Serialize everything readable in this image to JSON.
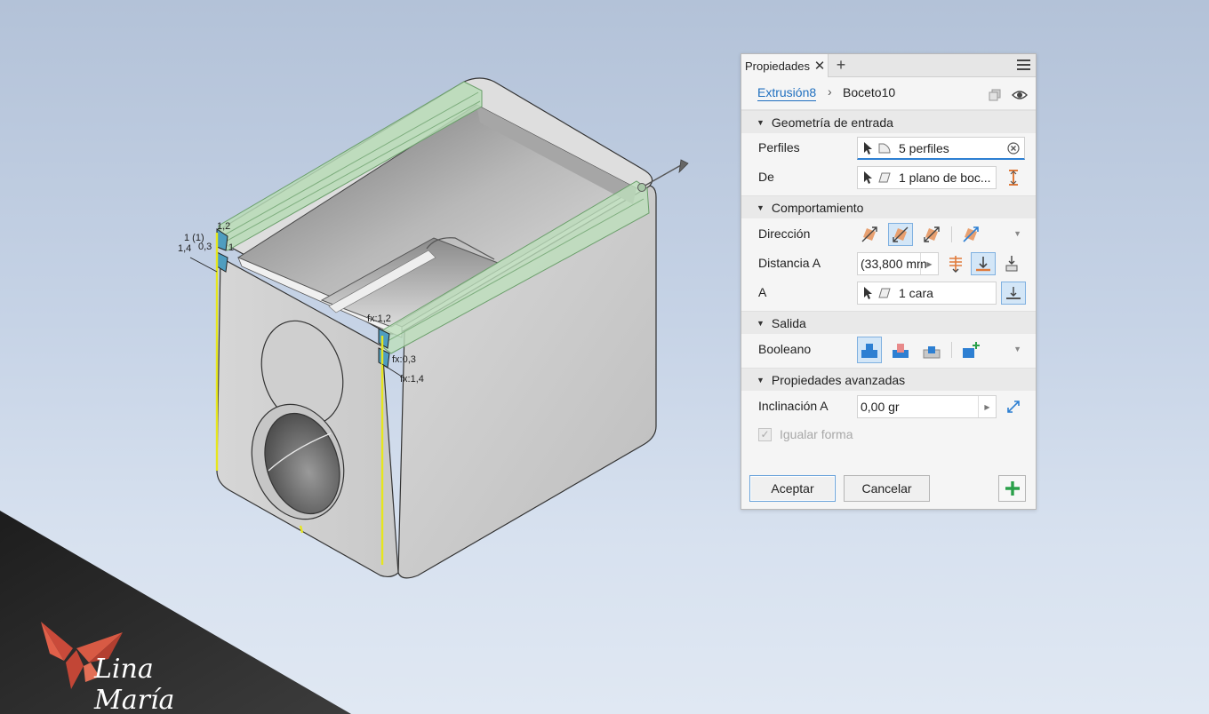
{
  "panel": {
    "tab_title": "Propiedades",
    "tab_close": "✕",
    "tab_add": "+",
    "breadcrumb": {
      "link": "Extrusión8",
      "separator": "›",
      "current": "Boceto10"
    },
    "sections": {
      "input_geometry": "Geometría de entrada",
      "behavior": "Comportamiento",
      "output": "Salida",
      "advanced": "Propiedades avanzadas"
    },
    "profiles": {
      "label": "Perfiles",
      "value": "5 perfiles"
    },
    "from": {
      "label": "De",
      "value": "1 plano de boc..."
    },
    "direction": {
      "label": "Dirección"
    },
    "distance": {
      "label": "Distancia A",
      "value": "(33,800 mm"
    },
    "to": {
      "label": "A",
      "value": "1 cara"
    },
    "boolean": {
      "label": "Booleano"
    },
    "taper": {
      "label": "Inclinación A",
      "value": "0,00 gr"
    },
    "match_shape": {
      "label": "Igualar forma",
      "checked": true,
      "enabled": false
    },
    "ok_button": "Aceptar",
    "cancel_button": "Cancelar",
    "colors": {
      "accent": "#1f6fbf",
      "active_bg": "#d3e6f7",
      "add_green": "#2aa04a",
      "orange": "#e07a3a"
    }
  },
  "viewport": {
    "dimensions": {
      "d1": "1,2",
      "d2": "1 (1)",
      "d3": "1,4",
      "d4": "0,3",
      "d5": "1",
      "fx1": "fx:1,2",
      "fx2": "fx:0,3",
      "fx3": "fx:1,4"
    }
  },
  "watermark": {
    "text": "Lina María"
  }
}
